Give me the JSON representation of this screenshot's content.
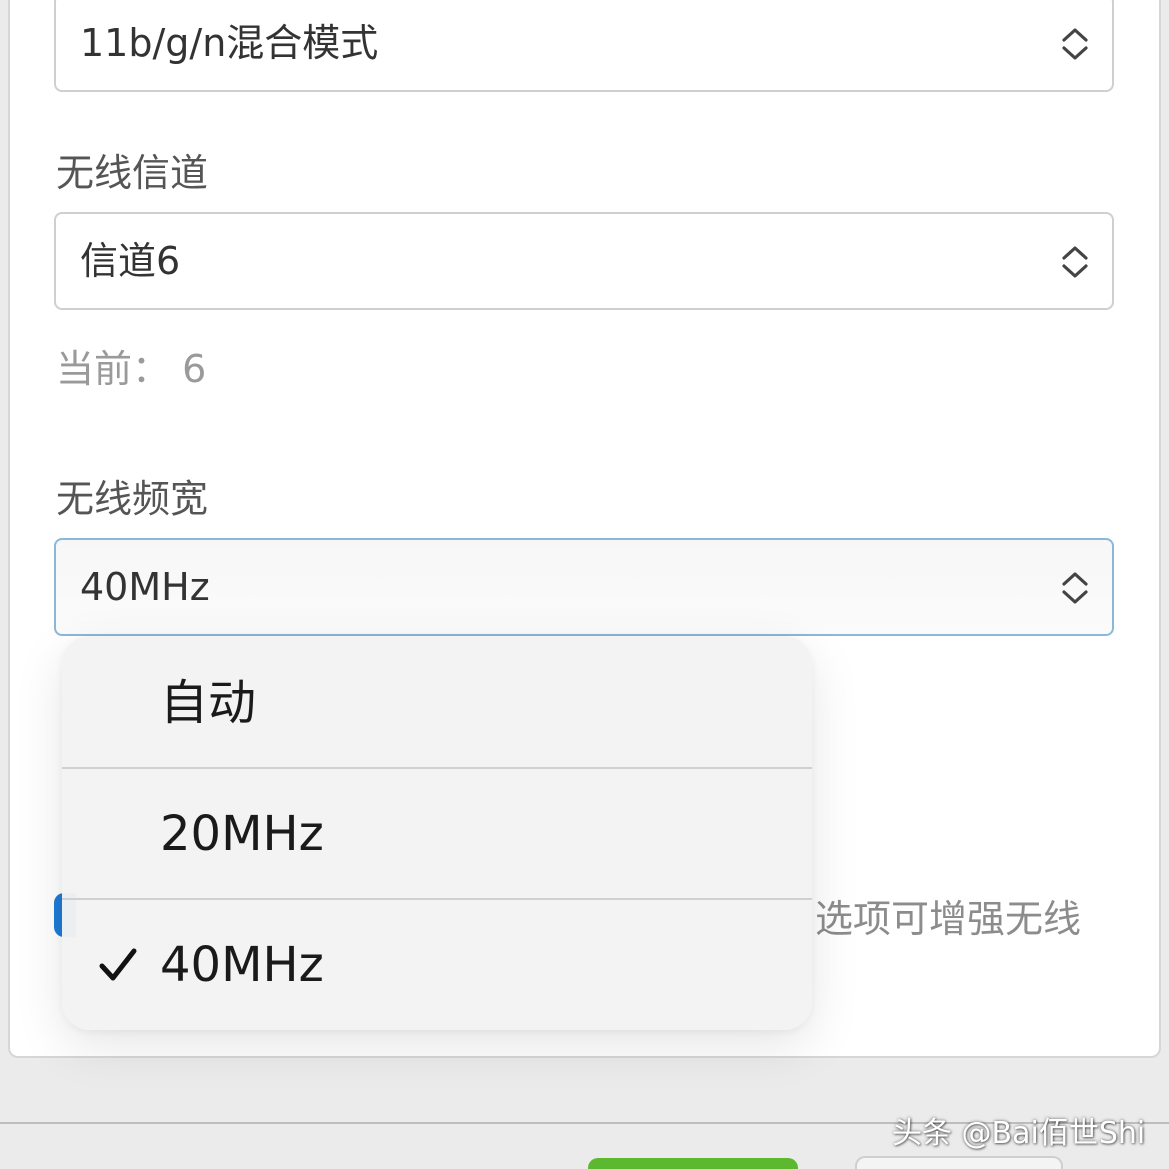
{
  "wireless_mode": {
    "value": "11b/g/n混合模式"
  },
  "wireless_channel": {
    "label": "无线信道",
    "value": "信道6",
    "current_hint": "当前： 6"
  },
  "wireless_bandwidth": {
    "label": "无线频宽",
    "value": "40MHz",
    "obscured_hint_fragment": "选项可增强无线"
  },
  "bandwidth_dropdown": {
    "options": [
      {
        "label": "自动",
        "selected": false
      },
      {
        "label": "20MHz",
        "selected": false
      },
      {
        "label": "40MHz",
        "selected": true
      }
    ],
    "check_glyph": "checkmark-icon"
  },
  "watermark": {
    "text": "头条 @Bai佰世Shi"
  },
  "colors": {
    "focus_border": "#8ab8d8",
    "toggle_blue": "#1f7bd6",
    "save_green": "#5cb82e"
  }
}
